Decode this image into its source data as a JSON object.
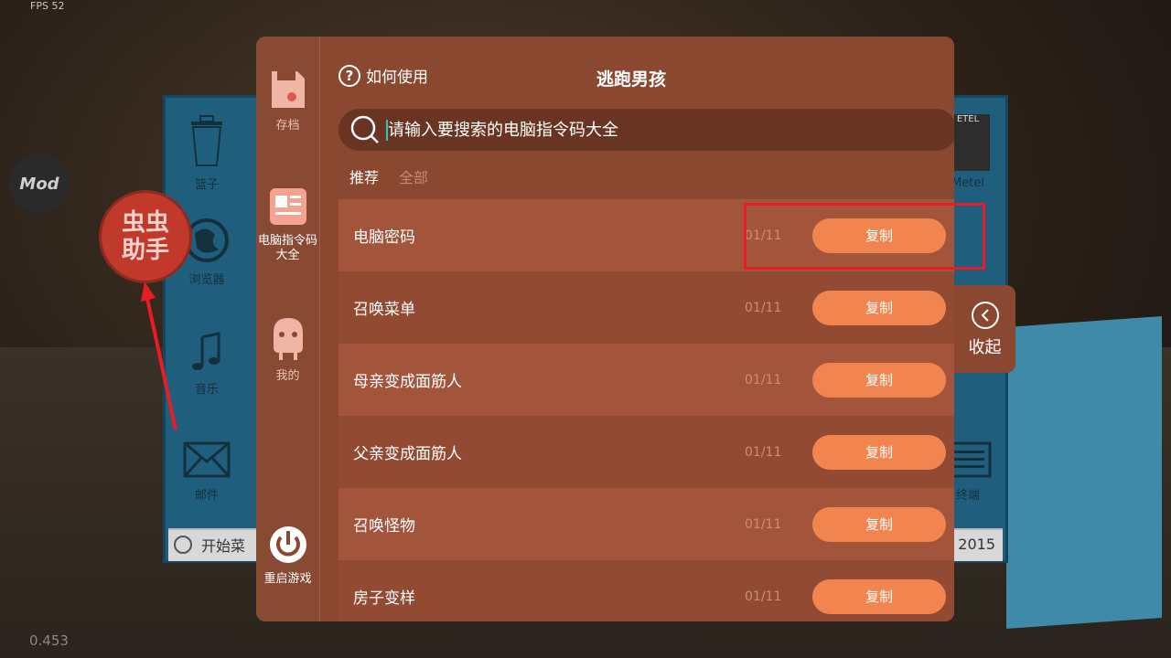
{
  "hud": {
    "fps": "FPS 52",
    "coord": "0.453"
  },
  "floating": {
    "mod_label": "Mod",
    "assistant_label": "虫虫助手"
  },
  "desktop": {
    "icons": [
      {
        "label": "篮子"
      },
      {
        "label": "浏览器"
      },
      {
        "label": "音乐"
      },
      {
        "label": "邮件"
      },
      {
        "label": "Metel"
      },
      {
        "label": "终端"
      }
    ],
    "taskbar": {
      "start_label": "开始菜",
      "year": "2015"
    }
  },
  "sidebar": {
    "items": [
      {
        "label": "存档",
        "icon": "save-icon"
      },
      {
        "label": "电脑指令码大全",
        "icon": "article-icon",
        "active": true
      },
      {
        "label": "我的",
        "icon": "profile-icon"
      },
      {
        "label": "重启游戏",
        "icon": "power-icon"
      }
    ]
  },
  "header": {
    "help_label": "如何使用",
    "title": "逃跑男孩"
  },
  "search": {
    "placeholder": "请输入要搜索的电脑指令码大全"
  },
  "tabs": [
    {
      "label": "推荐",
      "active": true
    },
    {
      "label": "全部"
    }
  ],
  "rows": [
    {
      "name": "电脑密码",
      "date": "01/11",
      "button": "复制"
    },
    {
      "name": "召唤菜单",
      "date": "01/11",
      "button": "复制"
    },
    {
      "name": "母亲变成面筋人",
      "date": "01/11",
      "button": "复制"
    },
    {
      "name": "父亲变成面筋人",
      "date": "01/11",
      "button": "复制"
    },
    {
      "name": "召唤怪物",
      "date": "01/11",
      "button": "复制"
    },
    {
      "name": "房子变样",
      "date": "01/11",
      "button": "复制"
    }
  ],
  "collapse": {
    "label": "收起"
  },
  "colors": {
    "panel": "#8a4830",
    "accent": "#f2844f",
    "highlight": "#e81c24"
  }
}
